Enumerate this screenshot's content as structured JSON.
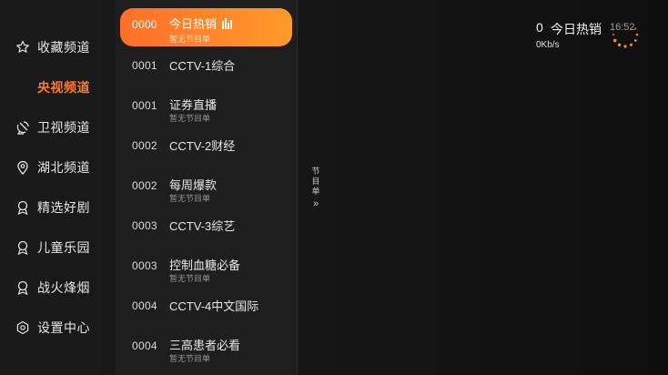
{
  "categories": [
    {
      "label": "收藏频道",
      "icon": "star-icon"
    },
    {
      "label": "央视频道",
      "icon": ""
    },
    {
      "label": "卫视频道",
      "icon": "satellite-icon"
    },
    {
      "label": "湖北频道",
      "icon": "location-icon"
    },
    {
      "label": "精选好剧",
      "icon": "ribbon-icon"
    },
    {
      "label": "儿童乐园",
      "icon": "ribbon-icon"
    },
    {
      "label": "战火烽烟",
      "icon": "ribbon-icon"
    },
    {
      "label": "设置中心",
      "icon": "gear-icon"
    }
  ],
  "active_category": "央视频道",
  "channels": [
    {
      "num": "0000",
      "name": "今日热销",
      "sub": "暂无节目单"
    },
    {
      "num": "0001",
      "name": "CCTV-1综合",
      "sub": ""
    },
    {
      "num": "0001",
      "name": "证券直播",
      "sub": "暂无节目单"
    },
    {
      "num": "0002",
      "name": "CCTV-2财经",
      "sub": ""
    },
    {
      "num": "0002",
      "name": "每周爆款",
      "sub": "暂无节目单"
    },
    {
      "num": "0003",
      "name": "CCTV-3综艺",
      "sub": ""
    },
    {
      "num": "0003",
      "name": "控制血糖必备",
      "sub": "暂无节目单"
    },
    {
      "num": "0004",
      "name": "CCTV-4中文国际",
      "sub": ""
    },
    {
      "num": "0004",
      "name": "三高患者必看",
      "sub": "暂无节目单"
    }
  ],
  "guide_tab": {
    "label": "节目单",
    "arrow": "»"
  },
  "now_playing": {
    "number": "0",
    "name": "今日热销",
    "speed": "0Kb/s",
    "time": "16:52"
  },
  "colors": {
    "accent": "#ff7a2a",
    "gradient_start": "#ff6f2a",
    "gradient_end": "#ff9a2a"
  }
}
